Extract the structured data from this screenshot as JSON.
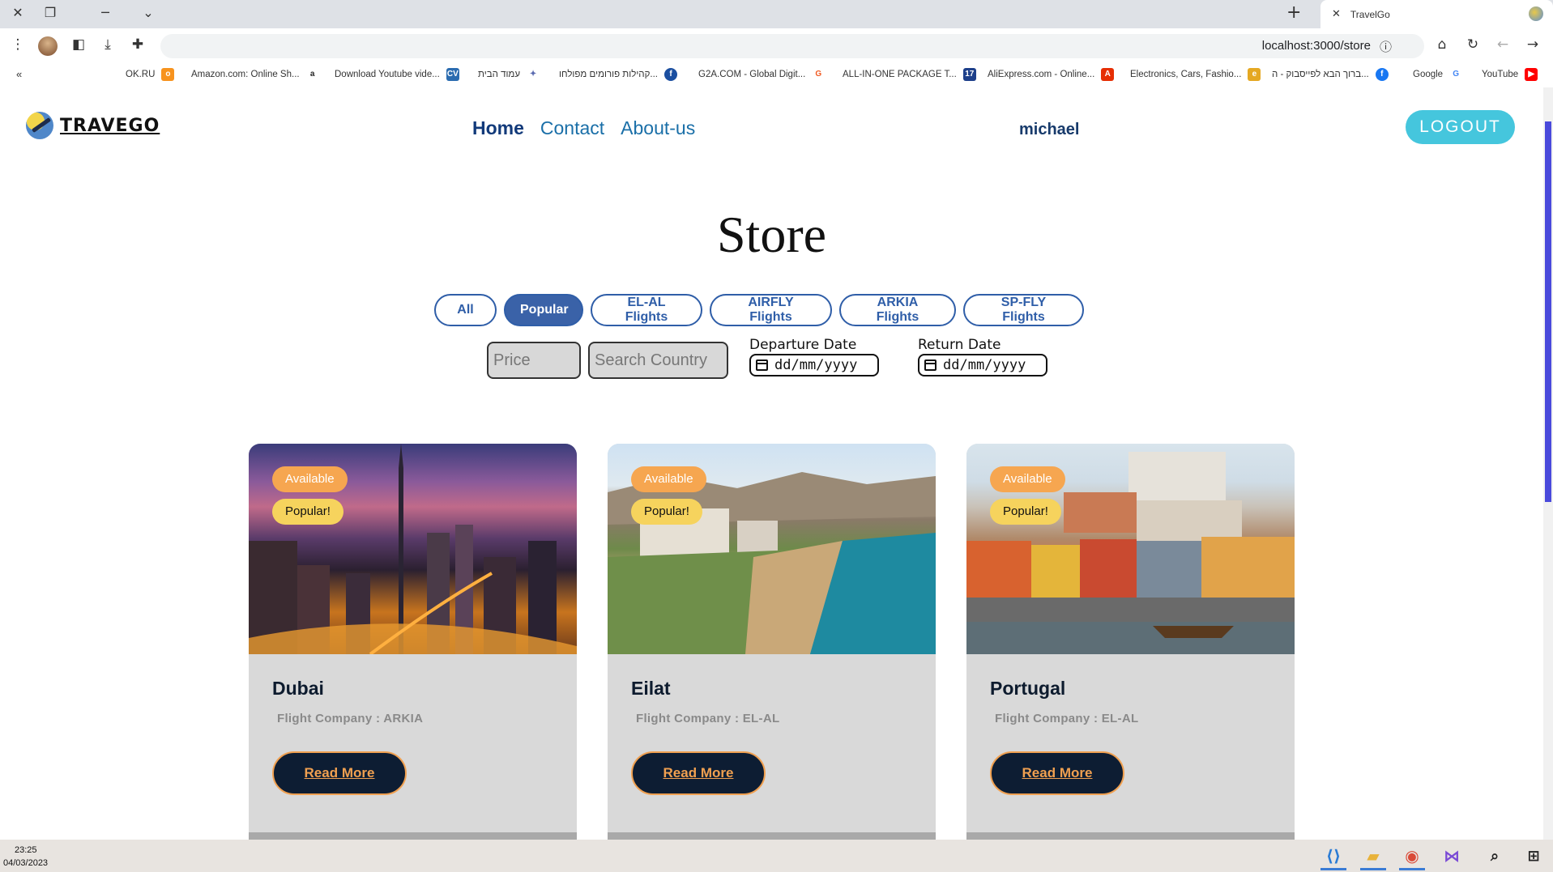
{
  "browser": {
    "tab_title": "TravelGo",
    "url": "localhost:3000/store",
    "bookmarks": [
      {
        "label": "OK.RU",
        "icon": "ok-icon",
        "color": "#f7931e",
        "glyph": "o"
      },
      {
        "label": "Amazon.com: Online Sh...",
        "icon": "amazon-icon",
        "color": "#222",
        "glyph": "a"
      },
      {
        "label": "Download Youtube vide...",
        "icon": "cv-icon",
        "color": "#2b6cb0",
        "glyph": "CV"
      },
      {
        "label": "עמוד הבית",
        "icon": "star-icon",
        "color": "#5a6ab0",
        "glyph": "✦"
      },
      {
        "label": "קהילות פורומים מפולחו...",
        "icon": "fxp-icon",
        "color": "#1b4fa0",
        "glyph": "f"
      },
      {
        "label": "G2A.COM - Global Digit...",
        "icon": "g2a-icon",
        "color": "#f05a22",
        "glyph": "G"
      },
      {
        "label": "ALL-IN-ONE PACKAGE T...",
        "icon": "17-icon",
        "color": "#1d3f8a",
        "glyph": "17"
      },
      {
        "label": "AliExpress.com - Online...",
        "icon": "aliexpress-icon",
        "color": "#e62e04",
        "glyph": "A"
      },
      {
        "label": "Electronics, Cars, Fashio...",
        "icon": "ebay-icon",
        "color": "#e5a822",
        "glyph": "e"
      },
      {
        "label": "ברוך הבא לפייסבוק - ה...",
        "icon": "facebook-icon",
        "color": "#1877f2",
        "glyph": "f"
      },
      {
        "label": "Google",
        "icon": "google-icon",
        "color": "#4285f4",
        "glyph": "G"
      },
      {
        "label": "YouTube",
        "icon": "youtube-icon",
        "color": "#ff0000",
        "glyph": "▶"
      }
    ]
  },
  "nav": {
    "logo_text": "TRAVEGO",
    "links": [
      "Home",
      "Contact",
      "About-us"
    ],
    "active_link": "Home",
    "username": "michael",
    "logout_label": "LOGOUT"
  },
  "store": {
    "title": "Store",
    "filters": [
      "All",
      "Popular",
      "EL-AL Flights",
      "AIRFLY Flights",
      "ARKIA Flights",
      "SP-FLY Flights"
    ],
    "active_filter": "Popular",
    "price_placeholder": "Price",
    "country_placeholder": "Search Country",
    "departure_label": "Departure Date",
    "return_label": "Return Date",
    "date_placeholder": "dd/mm/yyyy"
  },
  "cards": [
    {
      "name": "Dubai",
      "company": "Flight Company : ARKIA",
      "badge_available": "Available",
      "badge_popular": "Popular!",
      "button": "Read More"
    },
    {
      "name": "Eilat",
      "company": "Flight Company : EL-AL",
      "badge_available": "Available",
      "badge_popular": "Popular!",
      "button": "Read More"
    },
    {
      "name": "Portugal",
      "company": "Flight Company : EL-AL",
      "badge_available": "Available",
      "badge_popular": "Popular!",
      "button": "Read More"
    }
  ],
  "taskbar": {
    "time": "23:25",
    "date": "04/03/2023"
  },
  "colors": {
    "accent": "#3a62a8",
    "logout": "#45c6dd",
    "badge_available": "#f6a650",
    "badge_popular": "#f6d35d",
    "button_dark": "#0d1d33"
  }
}
